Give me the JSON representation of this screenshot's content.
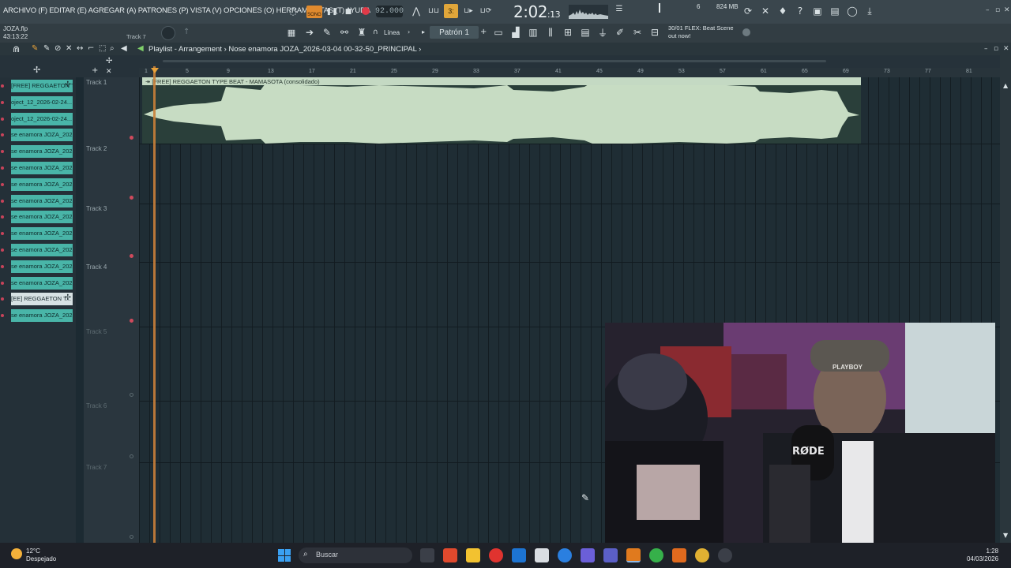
{
  "menubar": {
    "items": "ARCHIVO (F) EDITAR (E) AGREGAR (A) PATRONES (P) VISTA (V) OPCIONES (O) HERRAMIENTAS (T) AYUDA"
  },
  "transport": {
    "mode_label": "SONG",
    "tempo": "92.000",
    "time_main": "2:02",
    "time_sub": ":13",
    "memory": "824 MB",
    "cpu_count": "6"
  },
  "project": {
    "file": "JOZA.flp",
    "elapsed": "43:13:22",
    "hint": "Track 7"
  },
  "toolbar": {
    "snap_label": "Línea",
    "pattern_label": "Patrón 1",
    "news_line1": "30/01  FLEX: Beat Scene",
    "news_line2": "out now!"
  },
  "playlist": {
    "title": "Playlist - Arrangement  ›  Nose enamora JOZA_2026-03-04 00-32-50_PRINCIPAL  ›",
    "clip_title": "↠ [FREE] REGGAETON TYPE BEAT - MAMASOTA (consolidado)",
    "ruler": [
      "1",
      "5",
      "9",
      "13",
      "17",
      "21",
      "25",
      "29",
      "33",
      "37",
      "41",
      "45",
      "49",
      "53",
      "57",
      "61",
      "65",
      "69",
      "73",
      "77",
      "81"
    ],
    "tracks": [
      "Track 1",
      "Track 2",
      "Track 3",
      "Track 4",
      "Track 5",
      "Track 6",
      "Track 7"
    ]
  },
  "browser": {
    "items": [
      {
        "label": "[FREE] REGGAETON T...",
        "selected": false,
        "plus": true
      },
      {
        "label": "oject_12_2026-02-24...",
        "selected": false,
        "plus": false
      },
      {
        "label": "oject_12_2026-02-24...",
        "selected": false,
        "plus": false
      },
      {
        "label": "se enamora JOZA_202...",
        "selected": false,
        "plus": false
      },
      {
        "label": "se enamora JOZA_202...",
        "selected": false,
        "plus": false
      },
      {
        "label": "se enamora JOZA_202...",
        "selected": false,
        "plus": false
      },
      {
        "label": "se enamora JOZA_202...",
        "selected": false,
        "plus": false
      },
      {
        "label": "se enamora JOZA_202...",
        "selected": false,
        "plus": false
      },
      {
        "label": "se enamora JOZA_202...",
        "selected": false,
        "plus": false
      },
      {
        "label": "se enamora JOZA_202...",
        "selected": false,
        "plus": false
      },
      {
        "label": "se enamora JOZA_202...",
        "selected": false,
        "plus": false
      },
      {
        "label": "se enamora JOZA_202...",
        "selected": false,
        "plus": false
      },
      {
        "label": "se enamora JOZA_202...",
        "selected": false,
        "plus": false
      },
      {
        "label": "[EE] REGGAETON T...",
        "selected": true,
        "plus": true
      },
      {
        "label": "se enamora JOZA_202...",
        "selected": false,
        "plus": false
      }
    ]
  },
  "webcam": {
    "mic_brand": "RØDE",
    "cap_text": "PLAYBOY"
  },
  "taskbar": {
    "temperature": "12°C",
    "weather": "Despejado",
    "search_placeholder": "Buscar",
    "time": "1:28",
    "date": "04/03/2026"
  }
}
